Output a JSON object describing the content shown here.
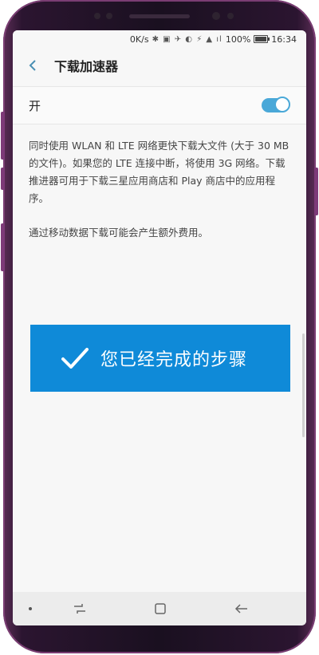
{
  "status_bar": {
    "speed": "0K/s",
    "icons": "✱ ▣ ✈ ◐ ⚡ ▲ ıl",
    "battery": "100%",
    "battery_level": 1.0,
    "time": "16:34"
  },
  "header": {
    "back_icon": "chevron-left-icon",
    "title": "下载加速器"
  },
  "toggle": {
    "label": "开",
    "state": "on",
    "accent_color": "#4aa8d8"
  },
  "description": {
    "paragraph1": "同时使用 WLAN 和 LTE 网络更快下载大文件 (大于 30 MB 的文件)。如果您的 LTE 连接中断，将使用 3G 网络。下载推进器可用于下载三星应用商店和 Play 商店中的应用程序。",
    "paragraph2": "通过移动数据下载可能会产生额外费用。"
  },
  "banner": {
    "text": "您已经完成的步骤",
    "icon": "checkmark-icon",
    "color": "#0f8ad8"
  },
  "nav_bar": {
    "recent_icon": "recent-apps-icon",
    "home_icon": "home-icon",
    "back_icon": "back-arrow-icon"
  }
}
